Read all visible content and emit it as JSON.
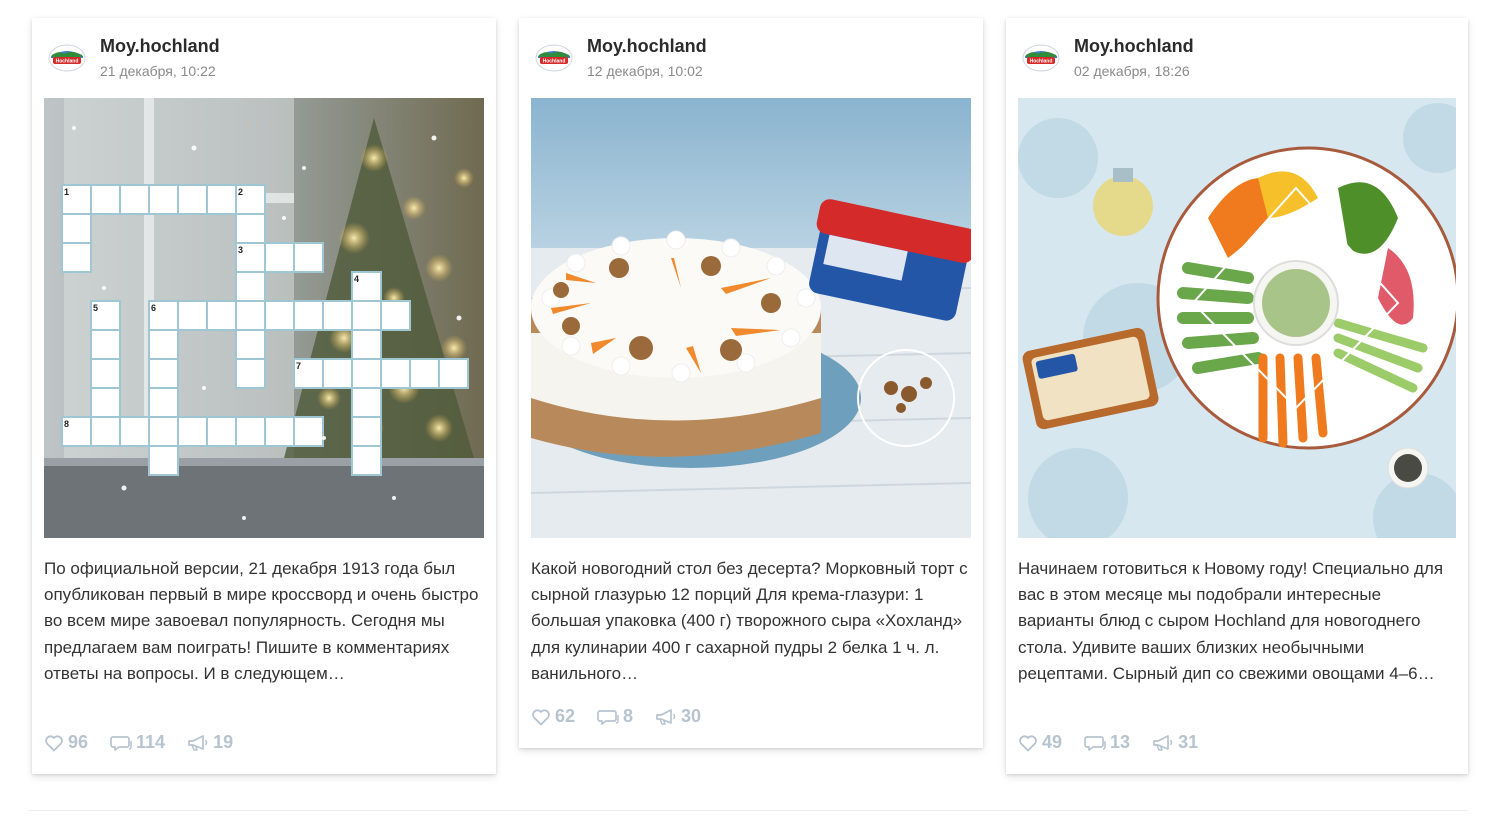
{
  "posts": [
    {
      "author": "Moy.hochland",
      "date": "21 декабря, 10:22",
      "text": "По официальной версии, 21 декабря 1913 года был опубликован первый в мире кроссворд и очень быстро во всем мире завоевал популярность. Сегодня мы предлагаем вам поиграть! Пишите в комментариях ответы на вопросы. И в следующем…",
      "likes": "96",
      "comments": "114",
      "reposts": "19",
      "image": "crossword",
      "crossword_numbers": [
        "1",
        "2",
        "3",
        "4",
        "5",
        "6",
        "7",
        "8"
      ]
    },
    {
      "author": "Moy.hochland",
      "date": "12 декабря, 10:02",
      "text": "Какой новогодний стол без десерта? Морковный торт с сырной глазурью 12 порций Для крема-глазури: 1 большая упаковка (400 г) творожного сыра «Хохланд» для кулинарии 400 г сахарной пудры 2 белка 1 ч. л. ванильного…",
      "likes": "62",
      "comments": "8",
      "reposts": "30",
      "image": "carrot-cake"
    },
    {
      "author": "Moy.hochland",
      "date": "02 декабря, 18:26",
      "text": "Начинаем готовиться к Новому году! Специально для вас в этом месяце мы подобрали интересные варианты блюд с сыром Hochland для новогоднего стола. Удивите ваших близких необычными рецептами. Сырный дип со свежими овощами 4–6…",
      "likes": "49",
      "comments": "13",
      "reposts": "31",
      "image": "vegetable-platter"
    }
  ],
  "icons": {
    "like": "heart-icon",
    "comment": "comment-icon",
    "repost": "megaphone-icon"
  },
  "colors": {
    "stat": "#b7c3cf",
    "text": "#333333",
    "date": "#8a8a8a",
    "brand_red": "#d42a2a",
    "brand_blue": "#1e4f9c"
  }
}
